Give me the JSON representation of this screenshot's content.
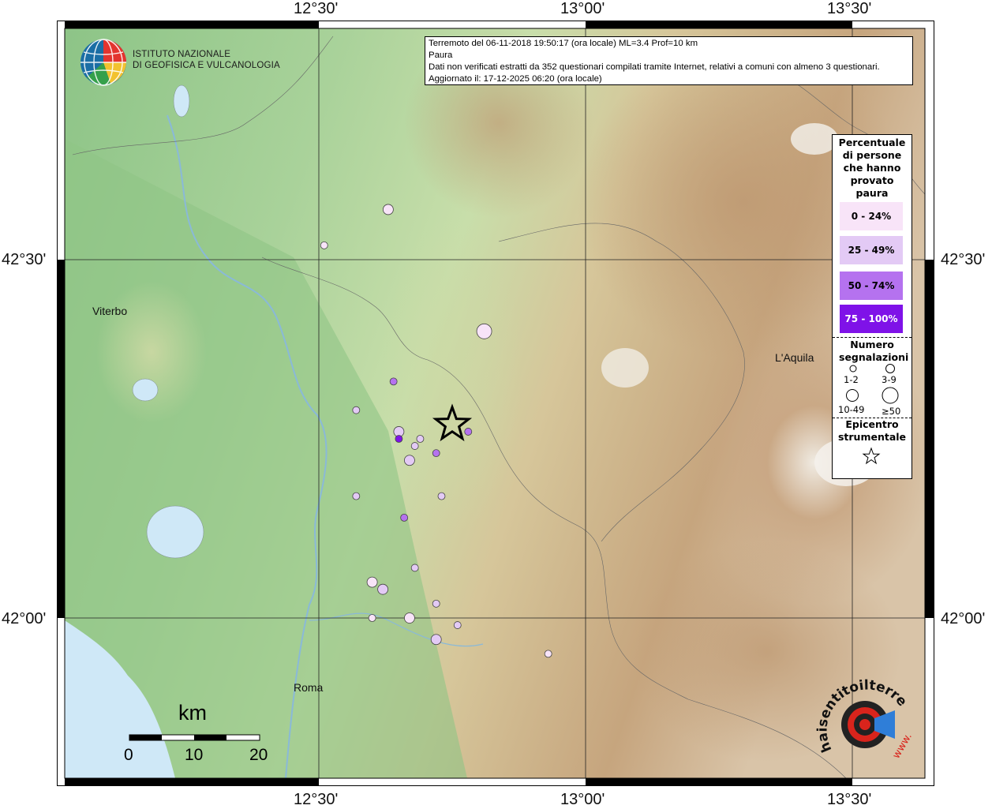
{
  "axes": {
    "top": [
      "12°30'",
      "13°00'",
      "13°30'"
    ],
    "bottom": [
      "12°30'",
      "13°00'",
      "13°30'"
    ],
    "left": [
      "42°30'",
      "42°00'"
    ],
    "right": [
      "42°30'",
      "42°00'"
    ]
  },
  "logo": {
    "line1": "ISTITUTO NAZIONALE",
    "line2": "DI GEOFISICA E VULCANOLOGIA"
  },
  "info": {
    "line1": "Terremoto del 06-11-2018 19:50:17 (ora locale) ML=3.4 Prof=10 km",
    "line2": "Paura",
    "line3": "Dati non verificati estratti da 352 questionari compilati tramite Internet, relativi a comuni con almeno 3 questionari.",
    "line4": "Aggiornato il: 17-12-2025 06:20 (ora locale)"
  },
  "legend": {
    "title": "Percentuale di persone che hanno provato paura",
    "classes": [
      {
        "label": "0 - 24%",
        "color": "#f8e4f8"
      },
      {
        "label": "25 - 49%",
        "color": "#e3caf5"
      },
      {
        "label": "50 - 74%",
        "color": "#b572ef"
      },
      {
        "label": "75 - 100%",
        "color": "#7f12e8"
      }
    ],
    "count_title": "Numero segnalazioni",
    "counts": [
      "1-2",
      "3-9",
      "10-49",
      "≥50"
    ],
    "epicenter_title": "Epicentro strumentale"
  },
  "places": {
    "viterbo": "Viterbo",
    "aquila": "L'Aquila",
    "roma": "Roma"
  },
  "scale": {
    "unit": "km",
    "ticks": [
      "0",
      "10",
      "20"
    ]
  },
  "badge": {
    "text": "haisentitoilterremoto.it",
    "url": "www."
  },
  "chart_data": {
    "type": "scatter",
    "title": "Terremoto del 06-11-2018 19:50:17 (ora locale) ML=3.4 Prof=10 km",
    "epicenter": {
      "lon": 12.75,
      "lat": 42.27
    },
    "xlim": [
      12.0,
      13.65
    ],
    "ylim": [
      41.8,
      42.82
    ],
    "points": [
      {
        "lon": 12.63,
        "lat": 42.57,
        "cls": 0,
        "n": "3-9"
      },
      {
        "lon": 12.51,
        "lat": 42.52,
        "cls": 0,
        "n": "1-2"
      },
      {
        "lon": 12.81,
        "lat": 42.4,
        "cls": 0,
        "n": "10-49"
      },
      {
        "lon": 12.64,
        "lat": 42.33,
        "cls": 2,
        "n": "1-2"
      },
      {
        "lon": 12.57,
        "lat": 42.29,
        "cls": 1,
        "n": "1-2"
      },
      {
        "lon": 12.65,
        "lat": 42.26,
        "cls": 1,
        "n": "3-9"
      },
      {
        "lon": 12.65,
        "lat": 42.25,
        "cls": 3,
        "n": "1-2"
      },
      {
        "lon": 12.69,
        "lat": 42.25,
        "cls": 1,
        "n": "1-2"
      },
      {
        "lon": 12.68,
        "lat": 42.24,
        "cls": 1,
        "n": "1-2"
      },
      {
        "lon": 12.78,
        "lat": 42.26,
        "cls": 2,
        "n": "1-2"
      },
      {
        "lon": 12.72,
        "lat": 42.23,
        "cls": 2,
        "n": "1-2"
      },
      {
        "lon": 12.67,
        "lat": 42.22,
        "cls": 1,
        "n": "3-9"
      },
      {
        "lon": 12.57,
        "lat": 42.17,
        "cls": 1,
        "n": "1-2"
      },
      {
        "lon": 12.73,
        "lat": 42.17,
        "cls": 1,
        "n": "1-2"
      },
      {
        "lon": 12.66,
        "lat": 42.14,
        "cls": 2,
        "n": "1-2"
      },
      {
        "lon": 12.68,
        "lat": 42.07,
        "cls": 1,
        "n": "1-2"
      },
      {
        "lon": 12.6,
        "lat": 42.05,
        "cls": 0,
        "n": "3-9"
      },
      {
        "lon": 12.62,
        "lat": 42.04,
        "cls": 1,
        "n": "3-9"
      },
      {
        "lon": 12.72,
        "lat": 42.02,
        "cls": 1,
        "n": "1-2"
      },
      {
        "lon": 12.6,
        "lat": 42.0,
        "cls": 0,
        "n": "1-2"
      },
      {
        "lon": 12.67,
        "lat": 42.0,
        "cls": 0,
        "n": "3-9"
      },
      {
        "lon": 12.76,
        "lat": 41.99,
        "cls": 1,
        "n": "1-2"
      },
      {
        "lon": 12.72,
        "lat": 41.97,
        "cls": 1,
        "n": "3-9"
      },
      {
        "lon": 12.93,
        "lat": 41.95,
        "cls": 0,
        "n": "1-2"
      }
    ]
  }
}
